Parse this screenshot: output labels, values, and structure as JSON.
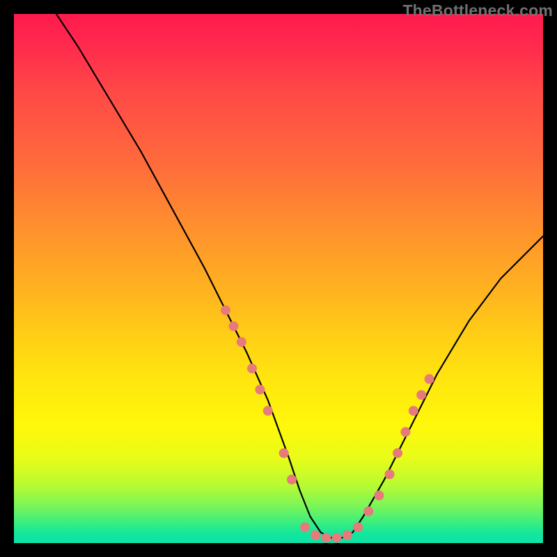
{
  "watermark": "TheBottleneck.com",
  "chart_data": {
    "type": "line",
    "title": "",
    "xlabel": "",
    "ylabel": "",
    "xlim": [
      0,
      100
    ],
    "ylim": [
      0,
      100
    ],
    "grid": false,
    "legend": false,
    "series": [
      {
        "name": "curve",
        "color": "#000000",
        "x": [
          8,
          12,
          18,
          24,
          30,
          36,
          40,
          44,
          48,
          52,
          54,
          56,
          58,
          60,
          62,
          64,
          66,
          70,
          74,
          80,
          86,
          92,
          98,
          100
        ],
        "y": [
          100,
          94,
          84,
          74,
          63,
          52,
          44,
          36,
          27,
          16,
          10,
          5,
          2,
          1,
          1,
          2,
          5,
          12,
          20,
          32,
          42,
          50,
          56,
          58
        ]
      }
    ],
    "markers": [
      {
        "group": "left-branch",
        "color": "#e77a7a",
        "points": [
          {
            "x": 40,
            "y": 44
          },
          {
            "x": 41.5,
            "y": 41
          },
          {
            "x": 43,
            "y": 38
          },
          {
            "x": 45,
            "y": 33
          },
          {
            "x": 46.5,
            "y": 29
          },
          {
            "x": 48,
            "y": 25
          },
          {
            "x": 51,
            "y": 17
          },
          {
            "x": 52.5,
            "y": 12
          }
        ]
      },
      {
        "group": "bottom",
        "color": "#e77a7a",
        "points": [
          {
            "x": 55,
            "y": 3
          },
          {
            "x": 57,
            "y": 1.5
          },
          {
            "x": 59,
            "y": 1
          },
          {
            "x": 61,
            "y": 1
          },
          {
            "x": 63,
            "y": 1.5
          },
          {
            "x": 65,
            "y": 3
          },
          {
            "x": 67,
            "y": 6
          },
          {
            "x": 69,
            "y": 9
          }
        ]
      },
      {
        "group": "right-branch",
        "color": "#e77a7a",
        "points": [
          {
            "x": 71,
            "y": 13
          },
          {
            "x": 72.5,
            "y": 17
          },
          {
            "x": 74,
            "y": 21
          },
          {
            "x": 75.5,
            "y": 25
          },
          {
            "x": 77,
            "y": 28
          },
          {
            "x": 78.5,
            "y": 31
          }
        ]
      }
    ]
  }
}
